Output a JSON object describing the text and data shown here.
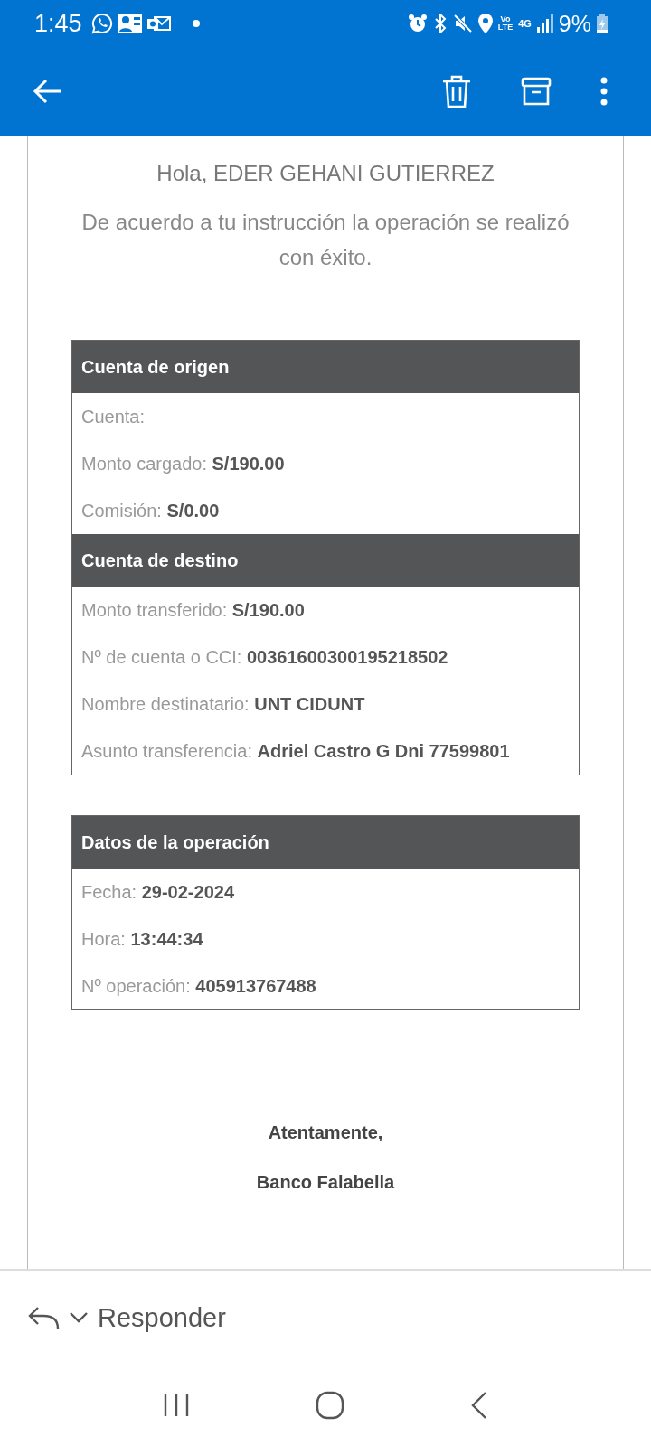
{
  "status_bar": {
    "time": "1:45",
    "network_volte": "Vo\nLTE",
    "network_type": "4G",
    "battery": "9%"
  },
  "email": {
    "greeting": "Hola, EDER GEHANI GUTIERREZ",
    "message": "De acuerdo a tu instrucción la operación se realizó con éxito.",
    "tables": [
      {
        "sections": [
          {
            "title": "Cuenta de origen",
            "rows": [
              "Cuenta:",
              "Monto cargado: **S/190.00**",
              "Comisión: **S/0.00**"
            ]
          },
          {
            "title": "Cuenta de destino",
            "rows": [
              "Monto transferido: **S/190.00**",
              "Nº de cuenta o CCI: **00361600300195218502**",
              "Nombre destinatario: **UNT CIDUNT**",
              "Asunto transferencia: **Adriel Castro G Dni 77599801**"
            ]
          }
        ]
      },
      {
        "sections": [
          {
            "title": "Datos de la operación",
            "rows": [
              "Fecha: **29-02-2024**",
              "Hora: **13:44:34**",
              "Nº operación: **405913767488**"
            ]
          }
        ]
      }
    ],
    "closing": "Atentamente,",
    "signature": "Banco Falabella"
  },
  "reply_bar": {
    "label": "Responder"
  }
}
